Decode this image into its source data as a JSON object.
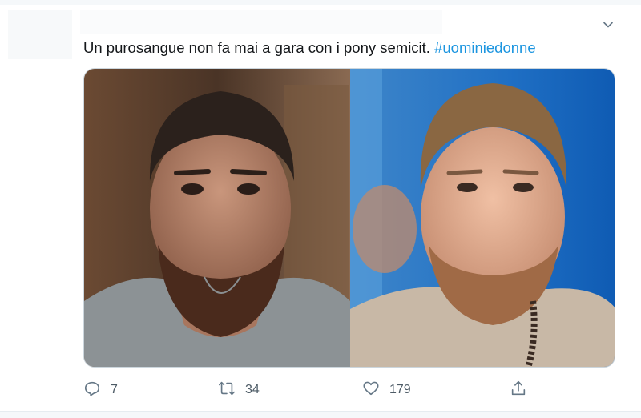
{
  "tweet": {
    "text": "Un purosangue non fa mai a gara con i pony semicit.",
    "hashtag": "#uominiedonne",
    "menu_icon": "chevron-down-icon",
    "media": {
      "description_icon": "photo"
    },
    "actions": {
      "reply": {
        "icon": "reply-icon",
        "count": "7"
      },
      "retweet": {
        "icon": "retweet-icon",
        "count": "34"
      },
      "like": {
        "icon": "heart-icon",
        "count": "179"
      },
      "share": {
        "icon": "share-icon"
      }
    }
  },
  "colors": {
    "link": "#1b95e0",
    "action": "#657786",
    "text": "#14171a"
  }
}
